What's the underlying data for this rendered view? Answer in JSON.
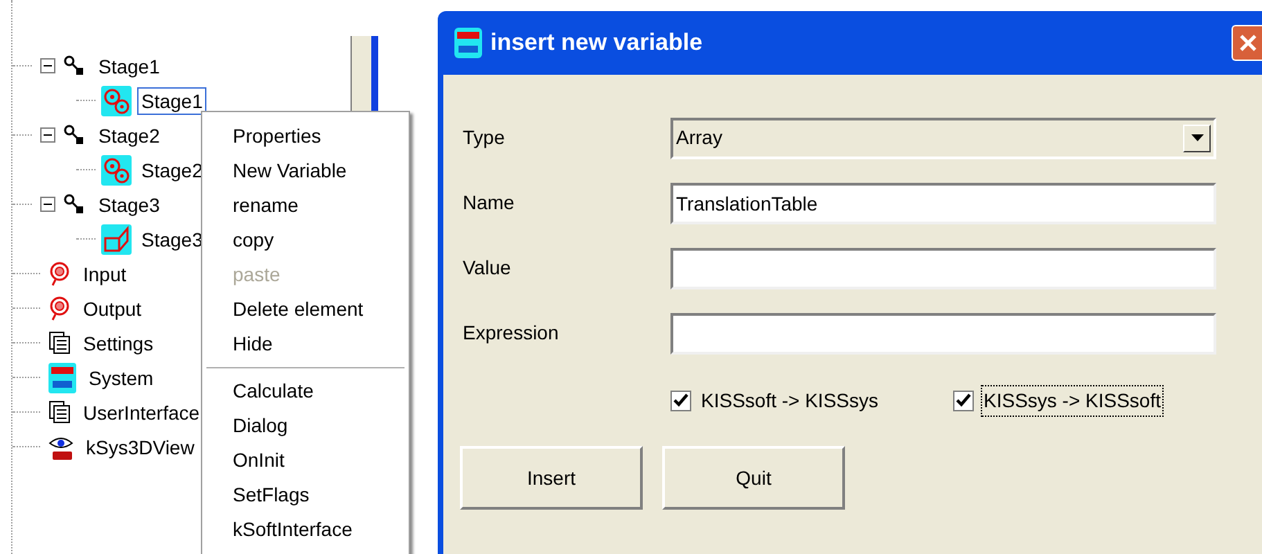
{
  "tree": [
    {
      "label": "Stage1",
      "kind": "stage",
      "expanded": true,
      "selected": false,
      "children": [
        {
          "label": "Stage1",
          "kind": "gears",
          "selected": true
        }
      ]
    },
    {
      "label": "Stage2",
      "kind": "stage",
      "expanded": true,
      "selected": false,
      "children": [
        {
          "label": "Stage2",
          "kind": "gears",
          "selected": false
        }
      ]
    },
    {
      "label": "Stage3",
      "kind": "stage",
      "expanded": true,
      "selected": false,
      "children": [
        {
          "label": "Stage3",
          "kind": "model",
          "selected": false
        }
      ]
    },
    {
      "label": "Input",
      "kind": "io",
      "selected": false
    },
    {
      "label": "Output",
      "kind": "io",
      "selected": false
    },
    {
      "label": "Settings",
      "kind": "document",
      "selected": false
    },
    {
      "label": "System",
      "kind": "system",
      "selected": false
    },
    {
      "label": "UserInterface",
      "kind": "document",
      "selected": false
    },
    {
      "label": "kSys3DView",
      "kind": "view",
      "selected": false
    }
  ],
  "context_menu": {
    "groups": [
      [
        {
          "label": "Properties",
          "disabled": false
        },
        {
          "label": "New Variable",
          "disabled": false
        },
        {
          "label": "rename",
          "disabled": false
        },
        {
          "label": "copy",
          "disabled": false
        },
        {
          "label": "paste",
          "disabled": true
        },
        {
          "label": "Delete element",
          "disabled": false
        },
        {
          "label": "Hide",
          "disabled": false
        }
      ],
      [
        {
          "label": "Calculate",
          "disabled": false
        },
        {
          "label": "Dialog",
          "disabled": false
        },
        {
          "label": "OnInit",
          "disabled": false
        },
        {
          "label": "SetFlags",
          "disabled": false
        },
        {
          "label": "kSoftInterface",
          "disabled": false
        }
      ]
    ]
  },
  "dialog": {
    "title": "insert new variable",
    "fields": [
      {
        "label": "Type",
        "kind": "dropdown",
        "value": "Array"
      },
      {
        "label": "Name",
        "kind": "text",
        "value": "TranslationTable"
      },
      {
        "label": "Value",
        "kind": "text"
      },
      {
        "label": "Expression",
        "kind": "text"
      }
    ],
    "checkboxes": [
      {
        "label": "KISSsoft -> KISSsys",
        "checked": true,
        "focused": false
      },
      {
        "label": "KISSsys -> KISSsoft",
        "checked": true,
        "focused": true
      }
    ],
    "buttons": [
      "Insert",
      "Quit"
    ]
  }
}
